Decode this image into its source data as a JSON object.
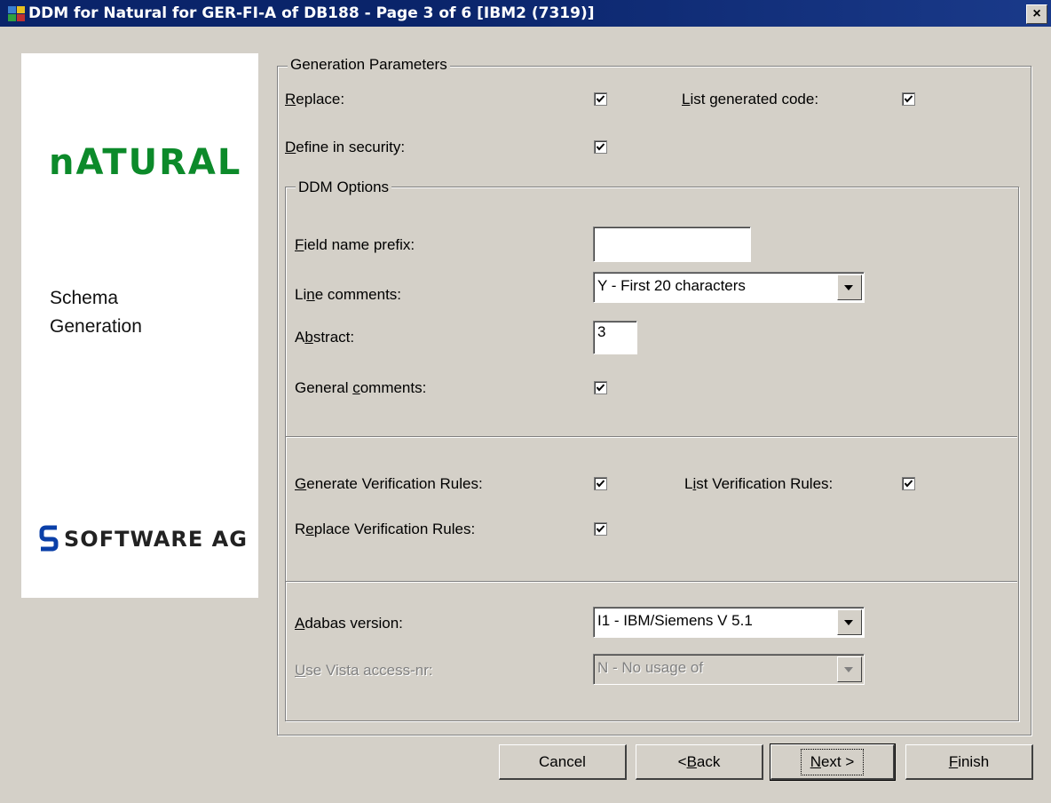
{
  "window": {
    "title": "DDM for Natural for GER-FI-A of DB188 - Page 3 of 6 [IBM2 (7319)]",
    "close_label": "×"
  },
  "branding": {
    "product_logo_text": "nATURAL",
    "panel_text_line1": "Schema",
    "panel_text_line2": "Generation",
    "vendor_logo_text": "SOFTWARE AG",
    "product_color": "#0c8a2a"
  },
  "generation_parameters": {
    "legend": "Generation Parameters",
    "replace": {
      "label_pre": "",
      "label_key": "R",
      "label_post": "eplace:",
      "checked": true
    },
    "list_generated_code": {
      "label_pre": "",
      "label_key": "L",
      "label_post": "ist generated code:",
      "checked": true
    },
    "define_in_security": {
      "label_pre": "",
      "label_key": "D",
      "label_post": "efine in security:",
      "checked": true
    }
  },
  "ddm_options": {
    "legend": "DDM Options",
    "field_name_prefix": {
      "label_pre": "",
      "label_key": "F",
      "label_post": "ield name prefix:",
      "value": ""
    },
    "line_comments": {
      "label_pre": "Li",
      "label_key": "n",
      "label_post": "e comments:",
      "value": "Y - First 20 characters"
    },
    "abstract": {
      "label_pre": "A",
      "label_key": "b",
      "label_post": "stract:",
      "value": "3"
    },
    "general_comments": {
      "label_pre": "General ",
      "label_key": "c",
      "label_post": "omments:",
      "checked": true
    }
  },
  "verification": {
    "generate": {
      "label_pre": "",
      "label_key": "G",
      "label_post": "enerate Verification Rules:",
      "checked": true
    },
    "list": {
      "label_pre": "L",
      "label_key": "i",
      "label_post": "st Verification Rules:",
      "checked": true
    },
    "replace": {
      "label_pre": "R",
      "label_key": "e",
      "label_post": "place Verification Rules:",
      "checked": true
    }
  },
  "adabas": {
    "version": {
      "label_pre": "",
      "label_key": "A",
      "label_post": "dabas version:",
      "value": "I1 - IBM/Siemens V 5.1"
    },
    "vista": {
      "label_pre": "",
      "label_key": "U",
      "label_post": "se Vista access-nr:",
      "value": "N - No usage of",
      "disabled": true
    }
  },
  "buttons": {
    "cancel": "Cancel",
    "back_pre": "<",
    "back_key": "B",
    "back_post": "ack",
    "next_pre": "",
    "next_key": "N",
    "next_post": "ext >",
    "finish_pre": "",
    "finish_key": "F",
    "finish_post": "inish"
  }
}
